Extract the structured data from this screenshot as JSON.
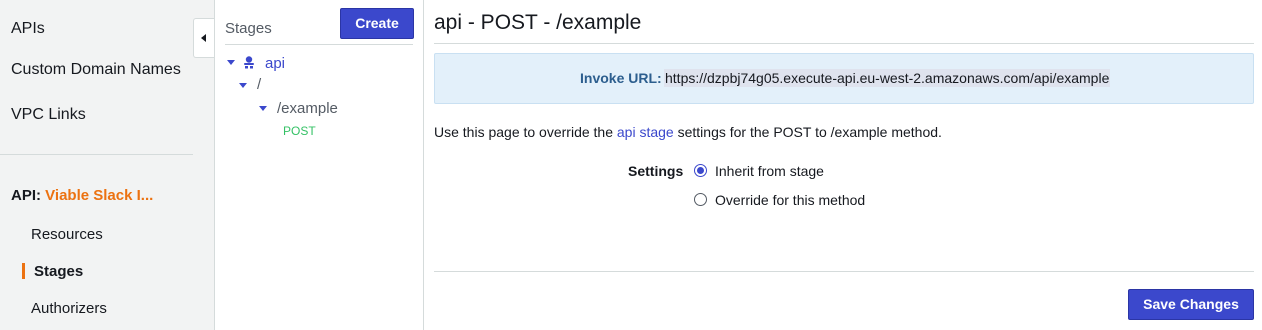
{
  "nav": {
    "links": [
      "APIs",
      "Custom Domain Names",
      "VPC Links"
    ],
    "api_prefix": "API:",
    "api_name": "Viable Slack I...",
    "subitems": [
      "Resources",
      "Stages",
      "Authorizers"
    ],
    "active_item": "Stages"
  },
  "stages_panel": {
    "title": "Stages",
    "create_label": "Create",
    "tree": {
      "stage": "api",
      "root": "/",
      "resource": "/example",
      "method": "POST"
    }
  },
  "main": {
    "title": "api - POST - /example",
    "invoke_label": "Invoke URL:",
    "invoke_url": "https://dzpbj74g05.execute-api.eu-west-2.amazonaws.com/api/example",
    "desc_before": "Use this page to override the ",
    "desc_link": "api stage",
    "desc_after": " settings for the POST to /example method.",
    "settings_label": "Settings",
    "options": [
      "Inherit from stage",
      "Override for this method"
    ],
    "selected_option": "Inherit from stage",
    "save_label": "Save Changes"
  },
  "colors": {
    "accent": "#3b48cc",
    "orange": "#ec7211",
    "method_green": "#34c165",
    "info_bg": "#e3f0fa"
  }
}
